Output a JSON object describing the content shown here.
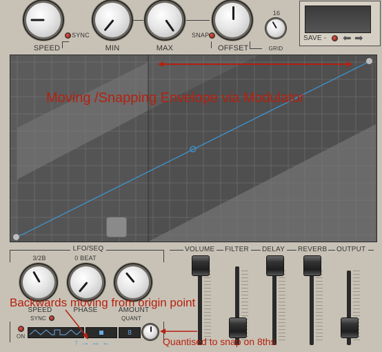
{
  "top_knobs": [
    {
      "label": "SPEED"
    },
    {
      "label": "MIN"
    },
    {
      "label": "MAX"
    },
    {
      "label": "OFFSET"
    }
  ],
  "sync_label": "SYNC",
  "snap_label": "SNAP",
  "grid": {
    "value": "16",
    "label": "GRID"
  },
  "save_label": "SAVE -",
  "display": {
    "annotation_title": "Moving /Snapping Envelope via Modulator"
  },
  "lfo": {
    "section_label": "LFO/SEQ",
    "speed_value": "3/2B",
    "phase_value": "0 BEAT",
    "speed_label": "SPEED",
    "phase_label": "PHASE",
    "amount_label": "AMOUNT",
    "sync_label": "SYNC",
    "quant_label": "QUANT",
    "on_label": "ON",
    "quant_value": "8",
    "arrows": "↑ → ↔ ←"
  },
  "mixer": {
    "channels": [
      "VOLUME",
      "FILTER",
      "DELAY",
      "REVERB",
      "OUTPUT"
    ]
  },
  "annotations": {
    "backwards": "Backwards moving from origin point",
    "quantised": "Quantised to snap on 8ths"
  },
  "colors": {
    "annotation": "#b5200f",
    "envelope": "#3a9ad9"
  }
}
